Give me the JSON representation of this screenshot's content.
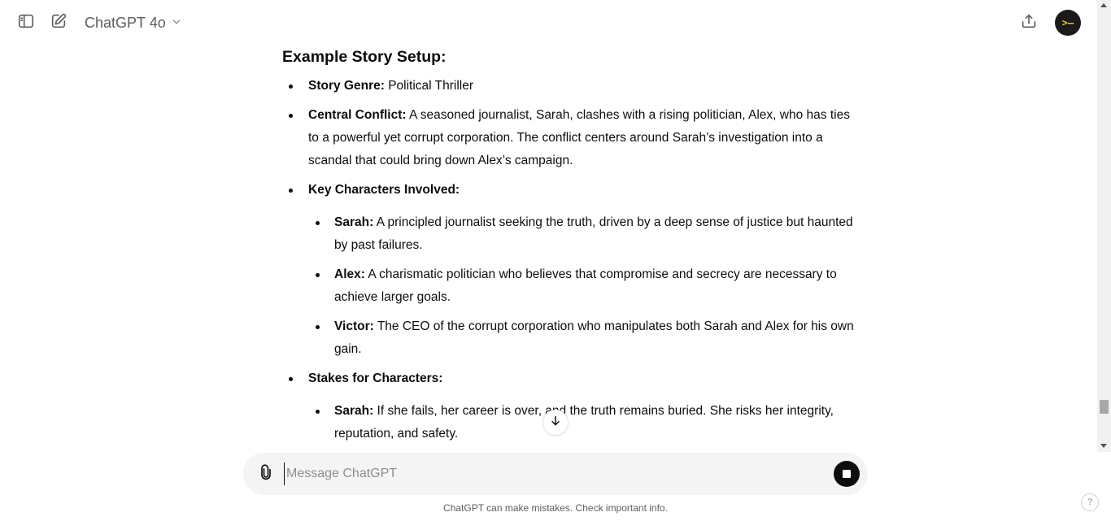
{
  "header": {
    "model_label": "ChatGPT 4o",
    "avatar_text": ">—"
  },
  "icons": {
    "sidebar_toggle": "sidebar-icon",
    "new_chat": "new-chat-icon",
    "model_dropdown": "chevron-down-icon",
    "share": "share-icon",
    "scroll_down": "arrow-down-icon",
    "attach": "paperclip-icon",
    "stop": "stop-icon"
  },
  "article": {
    "heading": "Example Story Setup:",
    "items": [
      {
        "label": "Story Genre:",
        "text": " Political Thriller"
      },
      {
        "label": "Central Conflict:",
        "text": " A seasoned journalist, Sarah, clashes with a rising politician, Alex, who has ties to a powerful yet corrupt corporation. The conflict centers around Sarah’s investigation into a scandal that could bring down Alex’s campaign."
      },
      {
        "label": "Key Characters Involved:",
        "text": ""
      },
      {
        "label": "Stakes for Characters:",
        "text": ""
      }
    ],
    "characters": [
      {
        "label": "Sarah:",
        "text": " A principled journalist seeking the truth, driven by a deep sense of justice but haunted by past failures."
      },
      {
        "label": "Alex:",
        "text": " A charismatic politician who believes that compromise and secrecy are necessary to achieve larger goals."
      },
      {
        "label": "Victor:",
        "text": " The CEO of the corrupt corporation who manipulates both Sarah and Alex for his own gain."
      }
    ],
    "stakes": [
      {
        "label": "Sarah:",
        "text": " If she fails, her career is over, and the truth remains buried. She risks her integrity, reputation, and safety."
      }
    ]
  },
  "composer": {
    "placeholder": "Message ChatGPT",
    "value": ""
  },
  "footer": {
    "disclaimer": "ChatGPT can make mistakes. Check important info.",
    "help": "?"
  },
  "colors": {
    "text": "#0d0d0d",
    "muted": "#5d5d5d",
    "composer_bg": "#f4f4f4",
    "avatar_bg": "#1a1a1a",
    "avatar_fg": "#f3c623"
  }
}
